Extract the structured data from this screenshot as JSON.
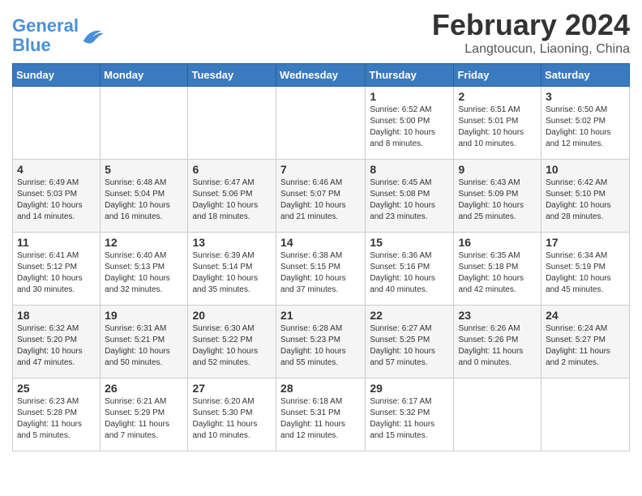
{
  "header": {
    "logo_line1": "General",
    "logo_line2": "Blue",
    "title": "February 2024",
    "subtitle": "Langtoucun, Liaoning, China"
  },
  "days_of_week": [
    "Sunday",
    "Monday",
    "Tuesday",
    "Wednesday",
    "Thursday",
    "Friday",
    "Saturday"
  ],
  "weeks": [
    [
      {
        "day": "",
        "info": ""
      },
      {
        "day": "",
        "info": ""
      },
      {
        "day": "",
        "info": ""
      },
      {
        "day": "",
        "info": ""
      },
      {
        "day": "1",
        "info": "Sunrise: 6:52 AM\nSunset: 5:00 PM\nDaylight: 10 hours\nand 8 minutes."
      },
      {
        "day": "2",
        "info": "Sunrise: 6:51 AM\nSunset: 5:01 PM\nDaylight: 10 hours\nand 10 minutes."
      },
      {
        "day": "3",
        "info": "Sunrise: 6:50 AM\nSunset: 5:02 PM\nDaylight: 10 hours\nand 12 minutes."
      }
    ],
    [
      {
        "day": "4",
        "info": "Sunrise: 6:49 AM\nSunset: 5:03 PM\nDaylight: 10 hours\nand 14 minutes."
      },
      {
        "day": "5",
        "info": "Sunrise: 6:48 AM\nSunset: 5:04 PM\nDaylight: 10 hours\nand 16 minutes."
      },
      {
        "day": "6",
        "info": "Sunrise: 6:47 AM\nSunset: 5:06 PM\nDaylight: 10 hours\nand 18 minutes."
      },
      {
        "day": "7",
        "info": "Sunrise: 6:46 AM\nSunset: 5:07 PM\nDaylight: 10 hours\nand 21 minutes."
      },
      {
        "day": "8",
        "info": "Sunrise: 6:45 AM\nSunset: 5:08 PM\nDaylight: 10 hours\nand 23 minutes."
      },
      {
        "day": "9",
        "info": "Sunrise: 6:43 AM\nSunset: 5:09 PM\nDaylight: 10 hours\nand 25 minutes."
      },
      {
        "day": "10",
        "info": "Sunrise: 6:42 AM\nSunset: 5:10 PM\nDaylight: 10 hours\nand 28 minutes."
      }
    ],
    [
      {
        "day": "11",
        "info": "Sunrise: 6:41 AM\nSunset: 5:12 PM\nDaylight: 10 hours\nand 30 minutes."
      },
      {
        "day": "12",
        "info": "Sunrise: 6:40 AM\nSunset: 5:13 PM\nDaylight: 10 hours\nand 32 minutes."
      },
      {
        "day": "13",
        "info": "Sunrise: 6:39 AM\nSunset: 5:14 PM\nDaylight: 10 hours\nand 35 minutes."
      },
      {
        "day": "14",
        "info": "Sunrise: 6:38 AM\nSunset: 5:15 PM\nDaylight: 10 hours\nand 37 minutes."
      },
      {
        "day": "15",
        "info": "Sunrise: 6:36 AM\nSunset: 5:16 PM\nDaylight: 10 hours\nand 40 minutes."
      },
      {
        "day": "16",
        "info": "Sunrise: 6:35 AM\nSunset: 5:18 PM\nDaylight: 10 hours\nand 42 minutes."
      },
      {
        "day": "17",
        "info": "Sunrise: 6:34 AM\nSunset: 5:19 PM\nDaylight: 10 hours\nand 45 minutes."
      }
    ],
    [
      {
        "day": "18",
        "info": "Sunrise: 6:32 AM\nSunset: 5:20 PM\nDaylight: 10 hours\nand 47 minutes."
      },
      {
        "day": "19",
        "info": "Sunrise: 6:31 AM\nSunset: 5:21 PM\nDaylight: 10 hours\nand 50 minutes."
      },
      {
        "day": "20",
        "info": "Sunrise: 6:30 AM\nSunset: 5:22 PM\nDaylight: 10 hours\nand 52 minutes."
      },
      {
        "day": "21",
        "info": "Sunrise: 6:28 AM\nSunset: 5:23 PM\nDaylight: 10 hours\nand 55 minutes."
      },
      {
        "day": "22",
        "info": "Sunrise: 6:27 AM\nSunset: 5:25 PM\nDaylight: 10 hours\nand 57 minutes."
      },
      {
        "day": "23",
        "info": "Sunrise: 6:26 AM\nSunset: 5:26 PM\nDaylight: 11 hours\nand 0 minutes."
      },
      {
        "day": "24",
        "info": "Sunrise: 6:24 AM\nSunset: 5:27 PM\nDaylight: 11 hours\nand 2 minutes."
      }
    ],
    [
      {
        "day": "25",
        "info": "Sunrise: 6:23 AM\nSunset: 5:28 PM\nDaylight: 11 hours\nand 5 minutes."
      },
      {
        "day": "26",
        "info": "Sunrise: 6:21 AM\nSunset: 5:29 PM\nDaylight: 11 hours\nand 7 minutes."
      },
      {
        "day": "27",
        "info": "Sunrise: 6:20 AM\nSunset: 5:30 PM\nDaylight: 11 hours\nand 10 minutes."
      },
      {
        "day": "28",
        "info": "Sunrise: 6:18 AM\nSunset: 5:31 PM\nDaylight: 11 hours\nand 12 minutes."
      },
      {
        "day": "29",
        "info": "Sunrise: 6:17 AM\nSunset: 5:32 PM\nDaylight: 11 hours\nand 15 minutes."
      },
      {
        "day": "",
        "info": ""
      },
      {
        "day": "",
        "info": ""
      }
    ]
  ]
}
